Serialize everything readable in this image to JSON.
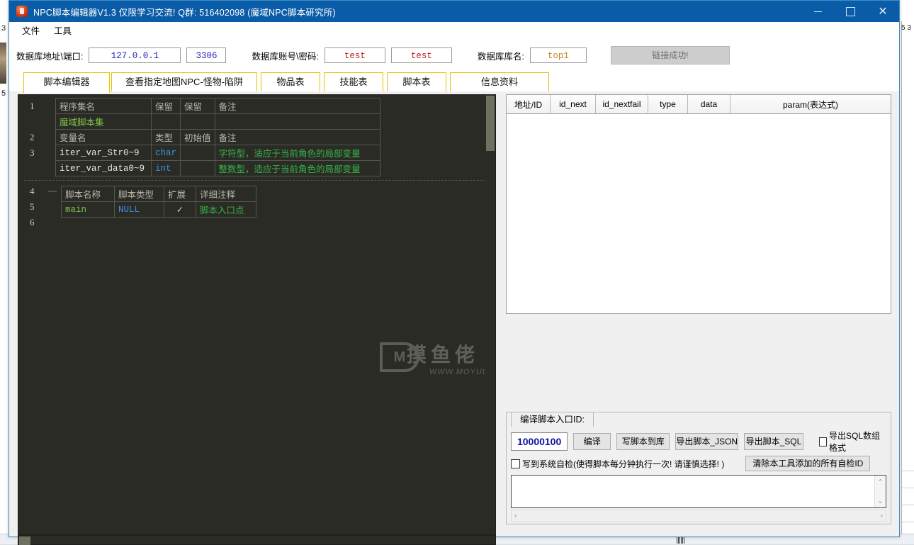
{
  "window": {
    "title": "NPC脚本编辑器V1.3 仅限学习交流!  Q群: 516402098 (魔域NPC脚本研究所)",
    "icon": "app-icon",
    "minimize": "—",
    "maximize": "□",
    "close": "✕"
  },
  "menu": {
    "items": [
      {
        "label": "文件"
      },
      {
        "label": "工具"
      }
    ]
  },
  "connection": {
    "addr_label": "数据库地址\\端口:",
    "host_value": "127.0.0.1",
    "port_value": "3306",
    "account_label": "数据库账号\\密码:",
    "user_value": "test",
    "pass_value": "test",
    "dbname_label": "数据库库名:",
    "dbname_value": "top1",
    "status_button": "链接成功!",
    "host_color": "#2727b5",
    "user_color": "#c02020",
    "db_color": "#d08020"
  },
  "tabs": {
    "items": [
      {
        "label": "脚本编辑器",
        "active": true
      },
      {
        "label": "查看指定地图NPC-怪物-陷阱",
        "active": false
      },
      {
        "label": "物品表",
        "active": false
      },
      {
        "label": "技能表",
        "active": false
      },
      {
        "label": "脚本表",
        "active": false
      },
      {
        "label": "信息资料",
        "active": false
      }
    ],
    "accent": "#e6c200"
  },
  "editor": {
    "line_numbers": [
      "1",
      "2",
      "3",
      "4",
      "5",
      "6"
    ],
    "fold_marker": "—",
    "table_program": {
      "headers": [
        "程序集名",
        "保留",
        "保留",
        "备注"
      ],
      "rows": [
        [
          "魔域脚本集",
          "",
          "",
          ""
        ]
      ]
    },
    "table_variables": {
      "headers": [
        "变量名",
        "类型",
        "初始值",
        "备注"
      ],
      "rows": [
        [
          "iter_var_Str0~9",
          "char",
          "",
          "字符型，适应于当前角色的局部变量"
        ],
        [
          "iter_var_data0~9",
          "int",
          "",
          "整数型，适应于当前角色的局部变量"
        ]
      ]
    },
    "table_script": {
      "headers": [
        "脚本名称",
        "脚本类型",
        "扩展",
        "详细注释"
      ],
      "rows": [
        [
          "main",
          "NULL",
          "✓",
          "脚本入口点"
        ]
      ]
    }
  },
  "watermark": {
    "text": "摸鱼佬",
    "url": "WWW.MOYULAO.COM",
    "logo": "M"
  },
  "grid": {
    "columns": [
      "地址/ID",
      "id_next",
      "id_nextfail",
      "type",
      "data",
      "param(表达式)"
    ],
    "rows": []
  },
  "compile": {
    "tab_label": "编译脚本入口ID:",
    "entry_id": "10000100",
    "buttons": [
      {
        "label": "编译"
      },
      {
        "label": "写脚本到库"
      },
      {
        "label": "导出脚本_JSON"
      },
      {
        "label": "导出脚本_SQL"
      }
    ],
    "checkbox_sql_array": "导出SQL数组格式",
    "checkbox_selfcheck": "写到系统自检(使得脚本每分钟执行一次! 请谨慎选择! )",
    "clear_button": "清除本工具添加的所有自检ID",
    "output_value": ""
  },
  "background": {
    "left_labels": [
      "3",
      "5"
    ],
    "right_label": "5 3"
  }
}
